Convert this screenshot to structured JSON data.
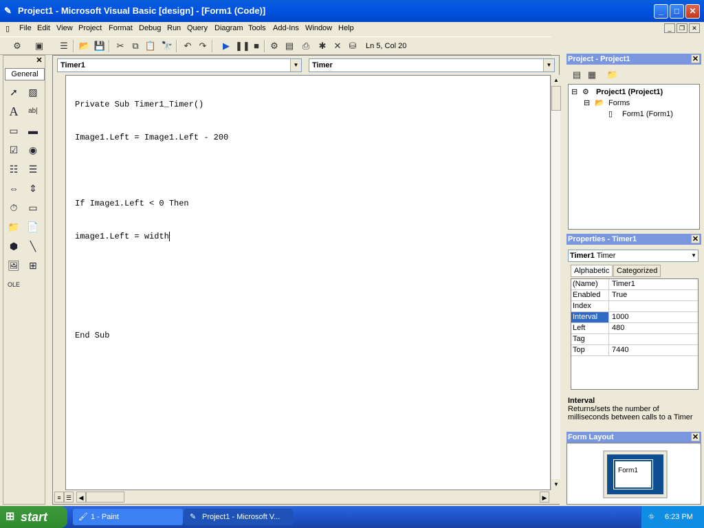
{
  "window": {
    "title": "Project1 - Microsoft Visual Basic [design] - [Form1 (Code)]",
    "min_icon": "minimize-icon",
    "max_icon": "maximize-icon",
    "close_icon": "close-icon"
  },
  "menu": [
    "File",
    "Edit",
    "View",
    "Project",
    "Format",
    "Debug",
    "Run",
    "Query",
    "Diagram",
    "Tools",
    "Add-Ins",
    "Window",
    "Help"
  ],
  "toolbar": {
    "position": "Ln 5, Col 20"
  },
  "toolbox": {
    "tab_label": "General"
  },
  "code": {
    "object_combo": "Timer1",
    "proc_combo": "Timer",
    "lines": [
      "Private Sub Timer1_Timer()",
      "Image1.Left = Image1.Left - 200",
      "",
      "If Image1.Left < 0 Then",
      "image1.Left = width",
      "",
      "",
      "End Sub"
    ]
  },
  "project": {
    "title": "Project - Project1",
    "root": "Project1 (Project1)",
    "folder": "Forms",
    "item": "Form1 (Form1)"
  },
  "properties": {
    "title": "Properties - Timer1",
    "object_name": "Timer1",
    "object_type": "Timer",
    "tab_alpha": "Alphabetic",
    "tab_cat": "Categorized",
    "rows": [
      {
        "key": "(Name)",
        "value": "Timer1"
      },
      {
        "key": "Enabled",
        "value": "True"
      },
      {
        "key": "Index",
        "value": ""
      },
      {
        "key": "Interval",
        "value": "1000"
      },
      {
        "key": "Left",
        "value": "480"
      },
      {
        "key": "Tag",
        "value": ""
      },
      {
        "key": "Top",
        "value": "7440"
      }
    ],
    "desc_title": "Interval",
    "desc_text": "Returns/sets the number of milliseconds between calls to a Timer"
  },
  "form_layout": {
    "title": "Form Layout",
    "form_label": "Form1"
  },
  "taskbar": {
    "start": "start",
    "tasks": [
      "1 - Paint",
      "Project1 - Microsoft V..."
    ],
    "clock": "6:23 PM"
  }
}
